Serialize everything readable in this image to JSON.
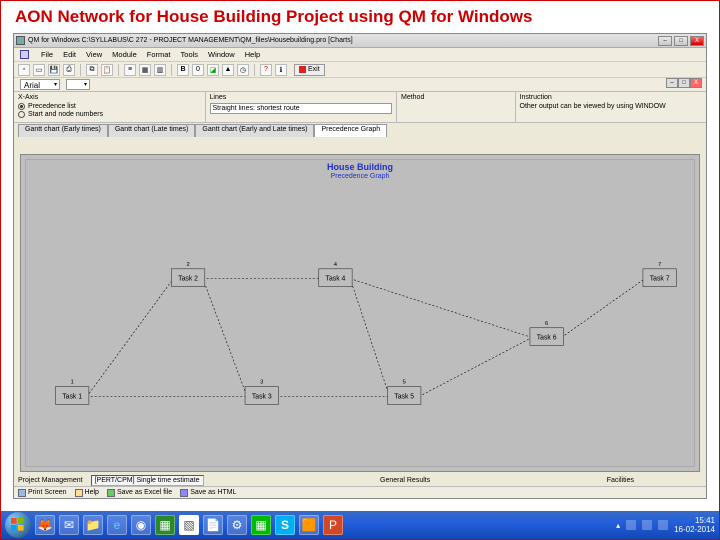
{
  "slide": {
    "title": "AON Network for House Building Project using QM for Windows"
  },
  "window": {
    "title": "QM for Windows  C:\\SYLLABUS\\C 272 - PROJECT MANAGEMENT\\QM_files\\Housebuilding.pro   [Charts]",
    "doc_buttons": [
      "–",
      "□",
      "X"
    ]
  },
  "menu": [
    "File",
    "Edit",
    "View",
    "Module",
    "Format",
    "Tools",
    "Window",
    "Help"
  ],
  "font": {
    "name": "Arial",
    "size": ""
  },
  "panels": {
    "xaxis": {
      "title": "X-Axis",
      "opt1": "Precedence list",
      "opt2": "Start and node numbers"
    },
    "lines": {
      "title": "Lines",
      "value": "Straight lines: shortest route"
    },
    "method": {
      "title": "Method"
    },
    "instruction": {
      "title": "Instruction",
      "text": "Other output can be viewed by using WINDOW"
    }
  },
  "tabs": [
    "Gantt chart (Early times)",
    "Gantt chart (Late times)",
    "Gantt chart (Early and Late times)",
    "Precedence Graph"
  ],
  "chart": {
    "title": "House Building",
    "subtitle": "Precedence Graph"
  },
  "nodes": {
    "n1": {
      "num": "1",
      "label": "Task 1"
    },
    "n2": {
      "num": "2",
      "label": "Task 2"
    },
    "n3": {
      "num": "3",
      "label": "Task 3"
    },
    "n4": {
      "num": "4",
      "label": "Task 4"
    },
    "n5": {
      "num": "5",
      "label": "Task 5"
    },
    "n6": {
      "num": "6",
      "label": "Task 6"
    },
    "n7": {
      "num": "7",
      "label": "Task 7"
    }
  },
  "status": {
    "cat_label": "Project Management",
    "gen_label": "General Results",
    "file_label": "Facilities",
    "proj": "[PERT/CPM] Single time estimate"
  },
  "bottom_bar": {
    "b1": "Print Screen",
    "b2": "Help",
    "b3": "Save as Excel file",
    "b4": "Save as HTML"
  },
  "tray": {
    "time": "15:41",
    "date": "16-02-2014"
  }
}
